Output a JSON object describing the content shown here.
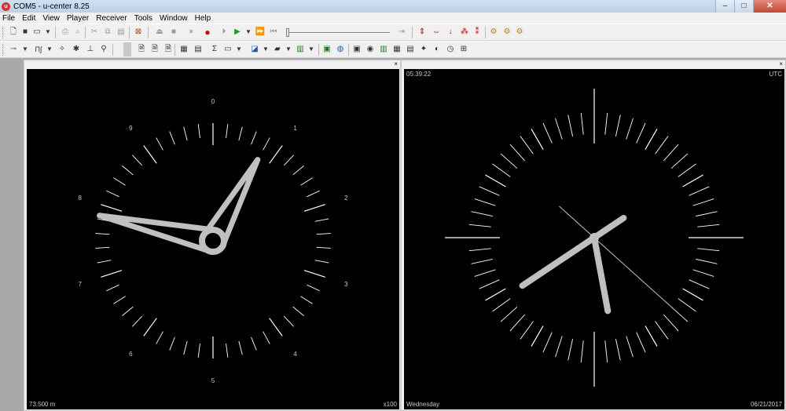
{
  "window": {
    "title": "COM5 - u-center 8.25",
    "icon_name": "u-center-app-icon",
    "controls": [
      "–",
      "□",
      "✕"
    ]
  },
  "menu": [
    "File",
    "Edit",
    "View",
    "Player",
    "Receiver",
    "Tools",
    "Window",
    "Help"
  ],
  "toolbar1": {
    "buttons": [
      "new-icon",
      "open-icon",
      "save-icon",
      "save-dropdown-icon",
      "print-icon",
      "print-preview-icon",
      "cut-icon",
      "copy-icon",
      "paste-icon",
      "export-icon",
      "eject-icon",
      "stop-icon",
      "pause-icon",
      "record-icon",
      "step-icon",
      "play-icon",
      "play-dropdown-icon",
      "fast-forward-icon",
      "rewind-icon",
      "end-icon",
      "height-icon",
      "width-icon",
      "clock-icon",
      "reset-icon",
      "settings-icon",
      "config-icon",
      "gear-icon"
    ],
    "slider_position_fraction": 0.0
  },
  "toolbar2": {
    "buttons": [
      "receiver-icon",
      "connection-dropdown-icon",
      "baudrate-icon",
      "baud-dropdown-icon",
      "magic-wand-icon",
      "bug-icon",
      "antenna-icon",
      "person-icon",
      "doc-a-icon",
      "doc-b-icon",
      "doc-c-icon",
      "table-icon",
      "list-icon",
      "sigma-icon",
      "view-icon",
      "view-dropdown-icon",
      "chart-icon",
      "chart-dropdown-icon",
      "signal-icon",
      "signal-dropdown-icon",
      "bar-icon",
      "bar-dropdown-icon",
      "monitor-icon",
      "globe-icon",
      "deviation-icon",
      "sky-icon",
      "bar-chart-icon",
      "map-icon",
      "compass-icon",
      "clock-view-icon",
      "satellite-icon"
    ]
  },
  "left_panel": {
    "name": "Altimeter",
    "dial_labels": [
      "0",
      "1",
      "2",
      "3",
      "4",
      "5",
      "6",
      "7",
      "8",
      "9"
    ],
    "bottom_left": "73.500 m",
    "bottom_right": "x100",
    "close_label": "×",
    "long_hand_value": 0.8,
    "short_hand_value": 7.85
  },
  "right_panel": {
    "name": "Clock",
    "top_left": "05:39:22",
    "top_right": "UTC",
    "bottom_left": "Wednesday",
    "bottom_right": "06/21/2017",
    "close_label": "×",
    "hour": 5,
    "minute": 39,
    "second": 22
  },
  "colors": {
    "screen_bg": "#000000",
    "hand": "#c0c0c0",
    "tick": "#ffffff",
    "text": "#c8c8c8"
  }
}
